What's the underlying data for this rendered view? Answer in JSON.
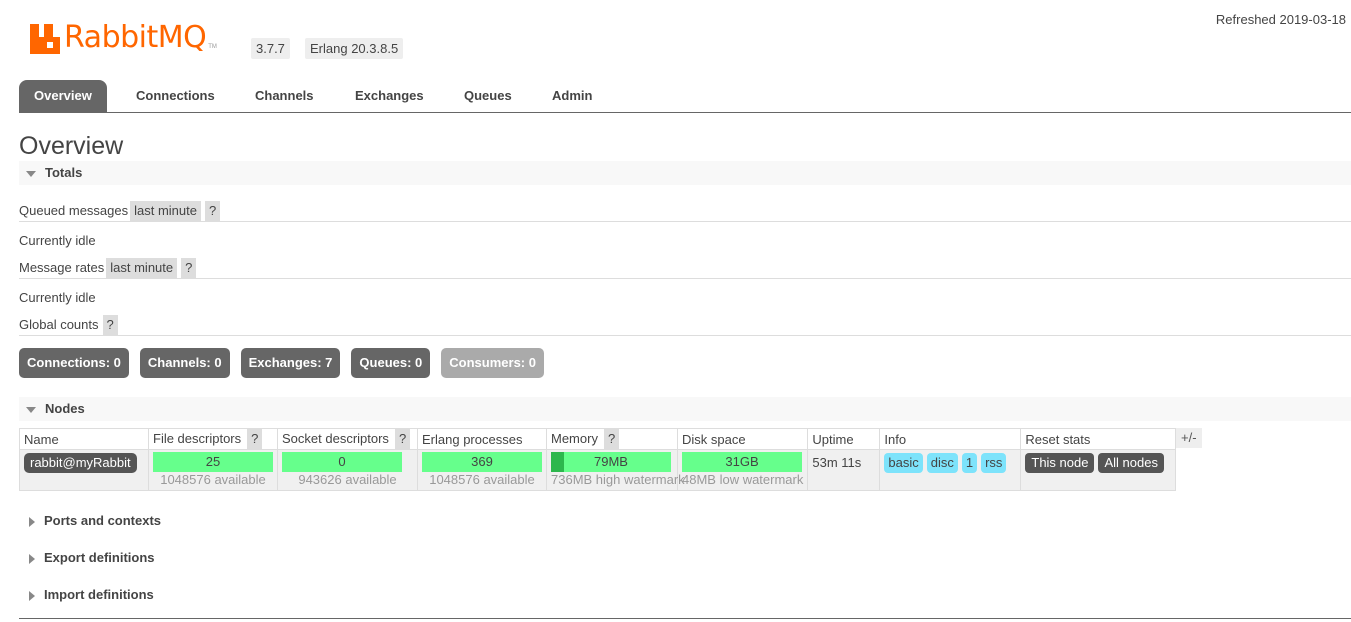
{
  "header": {
    "logo_text": "RabbitMQ",
    "logo_tm": "TM",
    "version": "3.7.7",
    "erlang": "Erlang 20.3.8.5",
    "refreshed": "Refreshed 2019-03-18"
  },
  "tabs": [
    {
      "label": "Overview",
      "active": true
    },
    {
      "label": "Connections",
      "active": false
    },
    {
      "label": "Channels",
      "active": false
    },
    {
      "label": "Exchanges",
      "active": false
    },
    {
      "label": "Queues",
      "active": false
    },
    {
      "label": "Admin",
      "active": false
    }
  ],
  "page_title": "Overview",
  "totals": {
    "heading": "Totals",
    "queued_label": "Queued messages",
    "queued_range": "last minute",
    "help": "?",
    "queued_idle": "Currently idle",
    "rates_label": "Message rates",
    "rates_range": "last minute",
    "rates_idle": "Currently idle",
    "global_label": "Global counts"
  },
  "counts": [
    {
      "label": "Connections: 0",
      "enabled": true
    },
    {
      "label": "Channels: 0",
      "enabled": true
    },
    {
      "label": "Exchanges: 7",
      "enabled": true
    },
    {
      "label": "Queues: 0",
      "enabled": true
    },
    {
      "label": "Consumers: 0",
      "enabled": false
    }
  ],
  "nodes": {
    "heading": "Nodes",
    "columns": [
      "Name",
      "File descriptors",
      "Socket descriptors",
      "Erlang processes",
      "Memory",
      "Disk space",
      "Uptime",
      "Info",
      "Reset stats"
    ],
    "plus_minus": "+/-",
    "row": {
      "name": "rabbit@myRabbit",
      "fd_value": "25",
      "fd_available": "1048576 available",
      "sd_value": "0",
      "sd_available": "943626 available",
      "ep_value": "369",
      "ep_available": "1048576 available",
      "memory_value": "79MB",
      "memory_fraction": 0.107,
      "memory_sub": "736MB high watermark",
      "disk_value": "31GB",
      "disk_sub": "48MB low watermark",
      "uptime": "53m 11s",
      "info_tags": [
        "basic",
        "disc",
        "1",
        "rss"
      ],
      "reset_this": "This node",
      "reset_all": "All nodes"
    }
  },
  "sections": {
    "ports": "Ports and contexts",
    "export": "Export definitions",
    "import": "Import definitions"
  },
  "colors": {
    "brand": "#ff6600",
    "bar_green": "#66ff8c",
    "info_blue": "#7de3fb",
    "tab_active": "#666666"
  }
}
